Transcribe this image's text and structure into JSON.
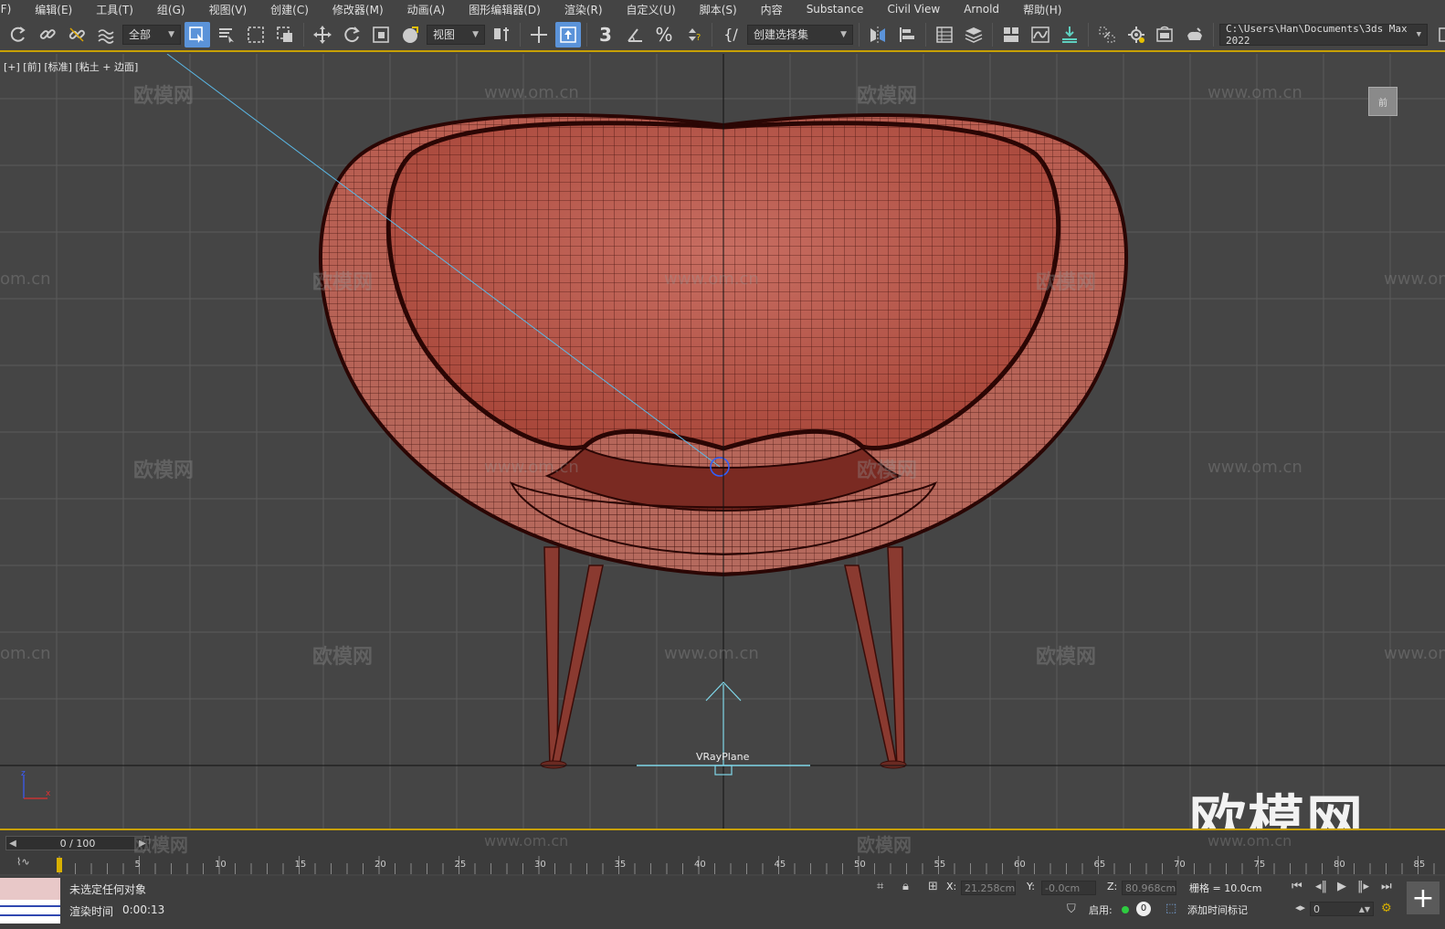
{
  "menu": [
    "文件(F)",
    "编辑(E)",
    "工具(T)",
    "组(G)",
    "视图(V)",
    "创建(C)",
    "修改器(M)",
    "动画(A)",
    "图形编辑器(D)",
    "渲染(R)",
    "自定义(U)",
    "脚本(S)",
    "内容",
    "Substance",
    "Civil View",
    "Arnold",
    "帮助(H)"
  ],
  "menu_first_visible": "(F)",
  "toolbar": {
    "filter_dropdown": "全部",
    "coord_dropdown": "视图",
    "selection_set_dropdown": "创建选择集",
    "path": "C:\\Users\\Han\\Documents\\3ds Max 2022"
  },
  "viewport": {
    "label": "[+] [前] [标准] [粘土 + 边面]",
    "object_label": "VRayPlane",
    "viewcube_label": "前",
    "watermark_cn": "欧模网",
    "watermark_url": "www.om.cn",
    "watermark_url_partial": "om.cn",
    "watermark_big": "欧模网"
  },
  "timeline": {
    "slider_value": "0 / 100",
    "ticks": [
      "5",
      "10",
      "15",
      "20",
      "25",
      "30",
      "35",
      "40",
      "45",
      "50",
      "55",
      "60",
      "65",
      "70",
      "75",
      "80",
      "85"
    ]
  },
  "status": {
    "selection_text": "未选定任何对象",
    "render_time_label": "渲染时间",
    "render_time_value": "0:00:13",
    "x_label": "X:",
    "x_value": "21.258cm",
    "y_label": "Y:",
    "y_value": "-0.0cm",
    "z_label": "Z:",
    "z_value": "80.968cm",
    "grid_text": "栅格 = 10.0cm",
    "enable_label": "启用:",
    "enable_count": "0",
    "add_time_tag": "添加时间标记",
    "frame_field": "0"
  },
  "colors": {
    "accent": "#c8a000",
    "active_button": "#5b93d9",
    "chair": "#b8584a",
    "wire": "#3a0c08",
    "grid": "#5a5a5a"
  }
}
